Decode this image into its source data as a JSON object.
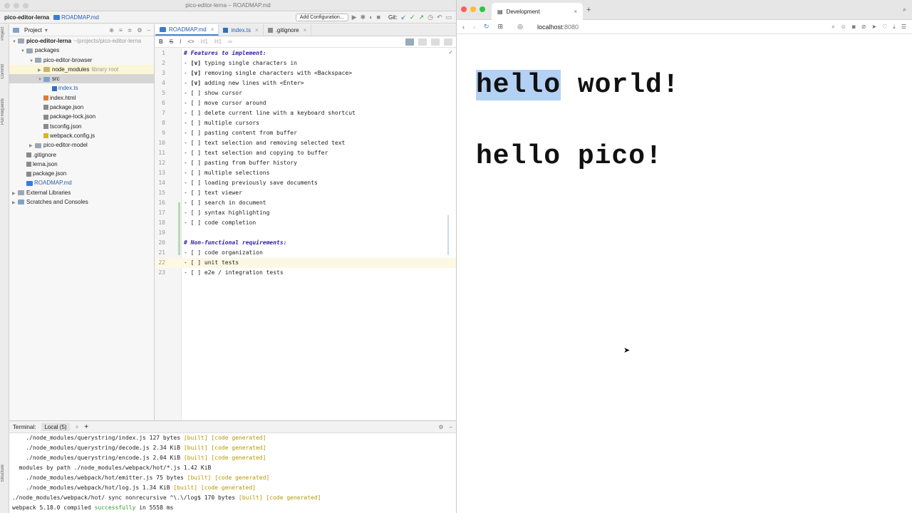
{
  "ide": {
    "window_title": "pico-editor-lerna – ROADMAP.md",
    "breadcrumb_project": "pico-editor-lerna",
    "breadcrumb_file": "ROADMAP.md",
    "add_config_label": "Add Configuration...",
    "git_label": "Git:",
    "stripe_labels": [
      "Project",
      "Commit",
      "Pull Requests",
      "Structure"
    ],
    "project_panel": {
      "title": "Project",
      "tree": [
        {
          "label": "pico-editor-lerna",
          "extra": "~/projects/pico-editor-lerna",
          "depth": 0,
          "kind": "root"
        },
        {
          "label": "packages",
          "depth": 1,
          "kind": "folder"
        },
        {
          "label": "pico-editor-browser",
          "depth": 2,
          "kind": "folder"
        },
        {
          "label": "node_modules",
          "extra": "library root",
          "depth": 3,
          "kind": "folder-lib"
        },
        {
          "label": "src",
          "depth": 3,
          "kind": "folder-src"
        },
        {
          "label": "index.ts",
          "depth": 4,
          "kind": "ts"
        },
        {
          "label": "index.html",
          "depth": 3,
          "kind": "html"
        },
        {
          "label": "package.json",
          "depth": 3,
          "kind": "json"
        },
        {
          "label": "package-lock.json",
          "depth": 3,
          "kind": "json"
        },
        {
          "label": "tsconfig.json",
          "depth": 3,
          "kind": "json"
        },
        {
          "label": "webpack.config.js",
          "depth": 3,
          "kind": "js"
        },
        {
          "label": "pico-editor-model",
          "depth": 2,
          "kind": "folder"
        },
        {
          "label": ".gitignore",
          "depth": 1,
          "kind": "file"
        },
        {
          "label": "lerna.json",
          "depth": 1,
          "kind": "json"
        },
        {
          "label": "package.json",
          "depth": 1,
          "kind": "json"
        },
        {
          "label": "ROADMAP.md",
          "depth": 1,
          "kind": "md"
        },
        {
          "label": "External Libraries",
          "depth": 0,
          "kind": "lib"
        },
        {
          "label": "Scratches and Consoles",
          "depth": 0,
          "kind": "scratch"
        }
      ]
    },
    "tabs": [
      {
        "label": "ROADMAP.md",
        "active": true
      },
      {
        "label": "index.ts",
        "active": false
      },
      {
        "label": ".gitignore",
        "active": false
      }
    ],
    "md_toolbar": [
      "B",
      "S",
      "I",
      "<>",
      "H1",
      "H1",
      "link"
    ],
    "code_lines": [
      {
        "n": "1",
        "text": "# Features to implement:",
        "style": "heading"
      },
      {
        "n": "2",
        "pre": "- ",
        "b": "[v]",
        "post": " typing single characters in"
      },
      {
        "n": "3",
        "pre": "- ",
        "b": "[v]",
        "post": " removing single characters with <Backspace>"
      },
      {
        "n": "4",
        "pre": "- ",
        "b": "[v]",
        "post": " adding new lines with <Enter>"
      },
      {
        "n": "5",
        "text": "- [ ] show cursor"
      },
      {
        "n": "6",
        "text": "- [ ] move cursor around"
      },
      {
        "n": "7",
        "text": "- [ ] delete current line with a keyboard shortcut"
      },
      {
        "n": "8",
        "text": "- [ ] multiple cursors"
      },
      {
        "n": "9",
        "text": "- [ ] pasting content from buffer"
      },
      {
        "n": "10",
        "text": "- [ ] text selection and removing selected text"
      },
      {
        "n": "11",
        "text": "- [ ] text selection and copying to buffer"
      },
      {
        "n": "12",
        "text": "- [ ] pasting from buffer history"
      },
      {
        "n": "13",
        "text": "- [ ] multiple selections"
      },
      {
        "n": "14",
        "text": "- [ ] loading previously save documents"
      },
      {
        "n": "15",
        "text": "- [ ] text viewer"
      },
      {
        "n": "16",
        "text": "- [ ] search in document"
      },
      {
        "n": "17",
        "text": "- [ ] syntax highlighting"
      },
      {
        "n": "18",
        "text": "- [ ] code completion"
      },
      {
        "n": "19",
        "text": ""
      },
      {
        "n": "20",
        "text": "# Non-functional requirements:",
        "style": "heading"
      },
      {
        "n": "21",
        "text": "- [ ] code organization"
      },
      {
        "n": "22",
        "text": "- [ ] unit tests",
        "current": true
      },
      {
        "n": "23",
        "text": "- [ ] e2e / integration tests"
      }
    ],
    "terminal": {
      "label": "Terminal:",
      "tab": "Local (5)",
      "lines": [
        {
          "indent": "    ",
          "path": "./node_modules/querystring/index.js",
          "size": " 127 bytes ",
          "built": "[built]",
          "gen": " [code generated]"
        },
        {
          "indent": "    ",
          "path": "./node_modules/querystring/decode.js",
          "size": " 2.34 KiB ",
          "built": "[built]",
          "gen": " [code generated]"
        },
        {
          "indent": "    ",
          "path": "./node_modules/querystring/encode.js",
          "size": " 2.04 KiB ",
          "built": "[built]",
          "gen": " [code generated]"
        },
        {
          "indent": "  ",
          "path": "modules by path ./node_modules/webpack/hot/*.js",
          "size": " 1.42 KiB",
          "built": "",
          "gen": ""
        },
        {
          "indent": "    ",
          "path": "./node_modules/webpack/hot/emitter.js",
          "size": " 75 bytes ",
          "built": "[built]",
          "gen": " [code generated]"
        },
        {
          "indent": "    ",
          "path": "./node_modules/webpack/hot/log.js",
          "size": " 1.34 KiB ",
          "built": "[built]",
          "gen": " [code generated]"
        },
        {
          "indent": "",
          "path": "./node_modules/webpack/hot/ sync nonrecursive ^\\.\\/log$",
          "size": " 170 bytes ",
          "built": "[built]",
          "gen": " [code generated]"
        }
      ],
      "last_line": {
        "pre": "webpack 5.18.0 compiled ",
        "ok": "successfully",
        "post": " in 5558 ms"
      }
    }
  },
  "browser": {
    "tab_title": "Development",
    "url_host": "localhost",
    "url_port": ":8080",
    "page": {
      "line1_selected": "hello",
      "line1_rest": " world!",
      "line2": "hello pico!"
    },
    "traffic_colors": [
      "#fe5f57",
      "#febc2e",
      "#28c840"
    ],
    "selection_color": "#b3d1f5"
  }
}
